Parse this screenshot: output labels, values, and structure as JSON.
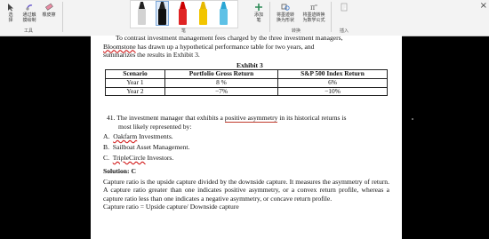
{
  "ribbon": {
    "tools": [
      {
        "label": "选\n择",
        "icon": "cursor-icon"
      },
      {
        "label": "通过触\n摸绘制",
        "icon": "touch-draw-icon"
      },
      {
        "label": "橡皮擦",
        "icon": "eraser-icon"
      }
    ],
    "tools_group": "工具",
    "pens_group": "笔",
    "add_pen": "添加\n笔",
    "convert": [
      {
        "label": "将墨迹转\n换为形状",
        "icon": "ink-to-shape-icon"
      },
      {
        "label": "将墨迹转换\n为数学公式",
        "icon": "ink-to-math-icon"
      }
    ],
    "convert_group": "转换",
    "insert": {
      "label": "",
      "icon": "insert-icon"
    },
    "insert_group": "插入",
    "pen_colors": [
      "#d3d3d3",
      "#111111",
      "#e02424",
      "#f2c500",
      "#5ec1e6"
    ]
  },
  "document": {
    "intro_line1": "To contrast investment management fees charged by the three investment managers,",
    "intro_line2a": "Bloomstone",
    "intro_line2b": " has drawn up a hypothetical performance table for two years, and",
    "intro_line3": "summarizes the results in Exhibit 3.",
    "exhibit_title": "Exhibit 3",
    "table": {
      "headers": [
        "Scenario",
        "Portfolio Gross Return",
        "S&P 500 Index Return"
      ],
      "rows": [
        [
          "Year 1",
          "8 %",
          "6%"
        ],
        [
          "Year 2",
          "−7%",
          "−10%"
        ]
      ]
    },
    "question": {
      "number": "41.",
      "text_a": "The investment manager that exhibits a ",
      "text_b": "positive asymmetry",
      "text_c": " in its historical returns is",
      "text_line2": "most likely represented by:",
      "options": [
        {
          "letter": "A.",
          "text_a": "Oakfarm",
          "text_b": " Investments."
        },
        {
          "letter": "B.",
          "text_a": "",
          "text_b": "Sailboat Asset Management."
        },
        {
          "letter": "C.",
          "text_a": "TripleCircle",
          "text_b": " Investors."
        }
      ]
    },
    "solution": {
      "title": "Solution: C",
      "para1": "Capture ratio is the upside capture divided by the downside capture. It measures the asymmetry of return. A capture ratio greater than one indicates positive asymmetry, or a convex return profile, whereas a capture ratio less than one indicates a negative asymmetry, or concave return profile.",
      "formula": "Capture ratio = Upside capture/ Downside capture"
    }
  }
}
